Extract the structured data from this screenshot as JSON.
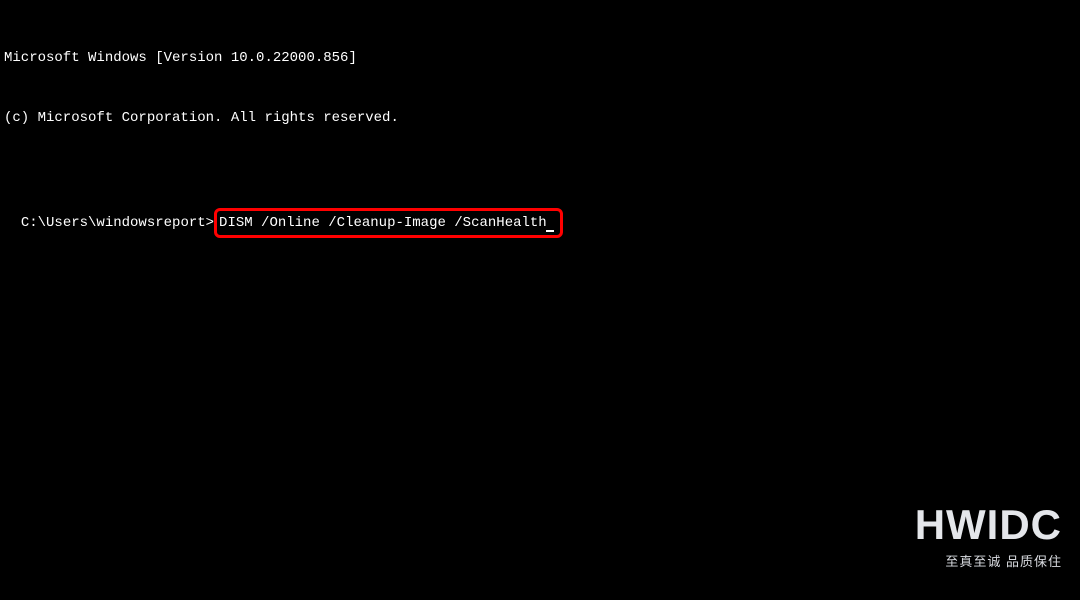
{
  "terminal": {
    "line1": "Microsoft Windows [Version 10.0.22000.856]",
    "line2": "(c) Microsoft Corporation. All rights reserved.",
    "prompt": "C:\\Users\\windowsreport>",
    "command": "DISM /Online /Cleanup-Image /ScanHealth"
  },
  "watermark": {
    "title": "HWIDC",
    "subtitle": "至真至诚 品质保住"
  }
}
